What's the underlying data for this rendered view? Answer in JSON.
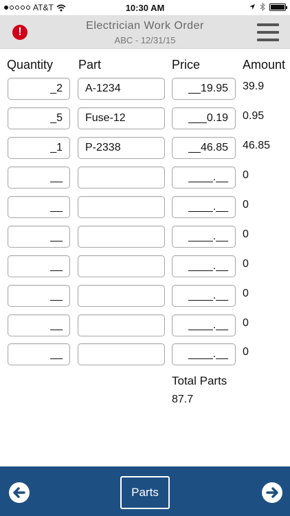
{
  "status_bar": {
    "carrier": "AT&T",
    "time": "10:30 AM"
  },
  "header": {
    "title": "Electrician Work Order",
    "subtitle": "ABC - 12/31/15"
  },
  "columns": {
    "quantity": "Quantity",
    "part": "Part",
    "price": "Price",
    "amount": "Amount"
  },
  "rows": [
    {
      "quantity": "_2",
      "part": "A-1234",
      "price": "__19.95",
      "amount": "39.9"
    },
    {
      "quantity": "_5",
      "part": "Fuse-12",
      "price": "___0.19",
      "amount": "0.95"
    },
    {
      "quantity": "_1",
      "part": "P-2338",
      "price": "__46.85",
      "amount": "46.85"
    },
    {
      "quantity": "__",
      "part": "",
      "price": "____.__",
      "amount": "0"
    },
    {
      "quantity": "__",
      "part": "",
      "price": "____.__",
      "amount": "0"
    },
    {
      "quantity": "__",
      "part": "",
      "price": "____.__",
      "amount": "0"
    },
    {
      "quantity": "__",
      "part": "",
      "price": "____.__",
      "amount": "0"
    },
    {
      "quantity": "__",
      "part": "",
      "price": "____.__",
      "amount": "0"
    },
    {
      "quantity": "__",
      "part": "",
      "price": "____.__",
      "amount": "0"
    },
    {
      "quantity": "__",
      "part": "",
      "price": "____.__",
      "amount": "0"
    }
  ],
  "totals": {
    "label": "Total Parts",
    "value": "87.7"
  },
  "bottom_bar": {
    "center_label": "Parts"
  },
  "colors": {
    "nav_background": "#e2e2e2",
    "bottom_bar": "#1e4f82",
    "alert": "#d0021b"
  }
}
